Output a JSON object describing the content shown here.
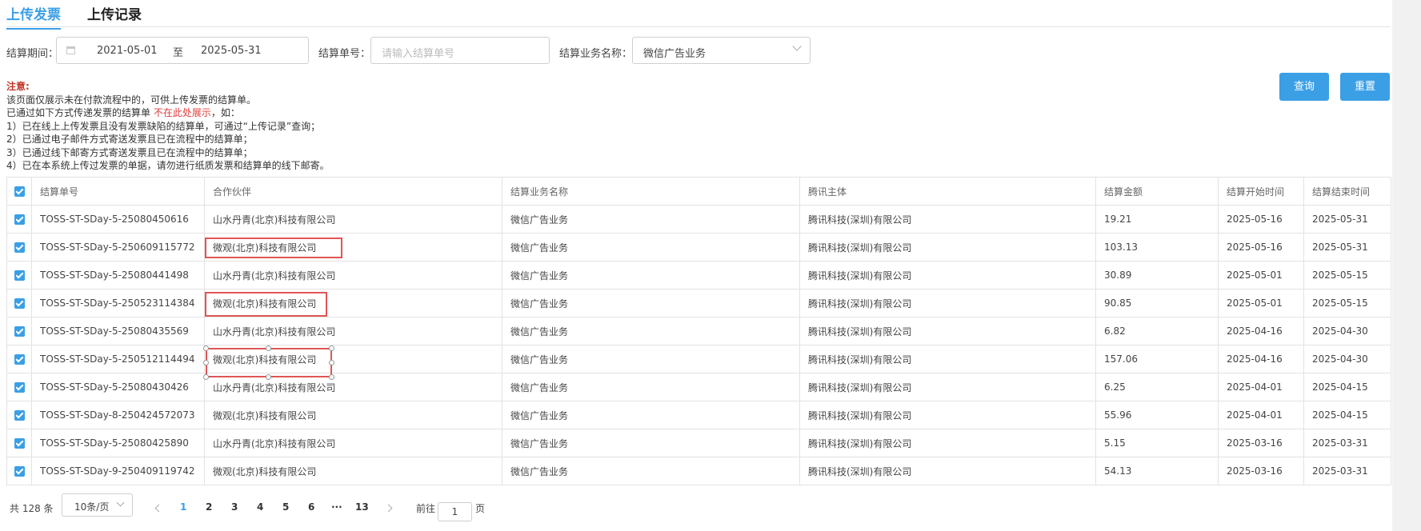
{
  "tabs": [
    {
      "label": "上传发票",
      "active": true
    },
    {
      "label": "上传记录",
      "active": false
    }
  ],
  "filters": {
    "period_label": "结算期间：",
    "start_date": "2021-05-01",
    "range_sep": "至",
    "end_date": "2025-05-31",
    "order_label": "结算单号：",
    "order_placeholder": "请输入结算单号",
    "biz_label": "结算业务名称：",
    "biz_value": "微信广告业务"
  },
  "buttons": {
    "query": "查询",
    "reset": "重置"
  },
  "notice": {
    "title": "注意:",
    "line1": "该页面仅展示未在付款流程中的，可供上传发票的结算单。",
    "line2_pre": "已通过如下方式传递发票的结算单 ",
    "line2_hl": "不在此处展示",
    "line2_post": "，如：",
    "items": [
      "1）已在线上上传发票且没有发票缺陷的结算单，可通过“上传记录”查询；",
      "2）已通过电子邮件方式寄送发票且已在流程中的结算单；",
      "3）已通过线下邮寄方式寄送发票且已在流程中的结算单；",
      "4）已在本系统上传过发票的单据，请勿进行纸质发票和结算单的线下邮寄。"
    ]
  },
  "table": {
    "headers": [
      "结算单号",
      "合作伙伴",
      "结算业务名称",
      "腾讯主体",
      "结算金额",
      "结算开始时间",
      "结算结束时间"
    ],
    "rows": [
      [
        "TOSS-ST-SDay-5-25080450616",
        "山水丹青(北京)科技有限公司",
        "微信广告业务",
        "腾讯科技(深圳)有限公司",
        "19.21",
        "2025-05-16",
        "2025-05-31"
      ],
      [
        "TOSS-ST-SDay-5-250609115772",
        "微观(北京)科技有限公司",
        "微信广告业务",
        "腾讯科技(深圳)有限公司",
        "103.13",
        "2025-05-16",
        "2025-05-31"
      ],
      [
        "TOSS-ST-SDay-5-25080441498",
        "山水丹青(北京)科技有限公司",
        "微信广告业务",
        "腾讯科技(深圳)有限公司",
        "30.89",
        "2025-05-01",
        "2025-05-15"
      ],
      [
        "TOSS-ST-SDay-5-250523114384",
        "微观(北京)科技有限公司",
        "微信广告业务",
        "腾讯科技(深圳)有限公司",
        "90.85",
        "2025-05-01",
        "2025-05-15"
      ],
      [
        "TOSS-ST-SDay-5-25080435569",
        "山水丹青(北京)科技有限公司",
        "微信广告业务",
        "腾讯科技(深圳)有限公司",
        "6.82",
        "2025-04-16",
        "2025-04-30"
      ],
      [
        "TOSS-ST-SDay-5-250512114494",
        "微观(北京)科技有限公司",
        "微信广告业务",
        "腾讯科技(深圳)有限公司",
        "157.06",
        "2025-04-16",
        "2025-04-30"
      ],
      [
        "TOSS-ST-SDay-5-25080430426",
        "山水丹青(北京)科技有限公司",
        "微信广告业务",
        "腾讯科技(深圳)有限公司",
        "6.25",
        "2025-04-01",
        "2025-04-15"
      ],
      [
        "TOSS-ST-SDay-8-250424572073",
        "微观(北京)科技有限公司",
        "微信广告业务",
        "腾讯科技(深圳)有限公司",
        "55.96",
        "2025-04-01",
        "2025-04-15"
      ],
      [
        "TOSS-ST-SDay-5-25080425890",
        "山水丹青(北京)科技有限公司",
        "微信广告业务",
        "腾讯科技(深圳)有限公司",
        "5.15",
        "2025-03-16",
        "2025-03-31"
      ],
      [
        "TOSS-ST-SDay-9-250409119742",
        "微观(北京)科技有限公司",
        "微信广告业务",
        "腾讯科技(深圳)有限公司",
        "54.13",
        "2025-03-16",
        "2025-03-31"
      ]
    ]
  },
  "pagination": {
    "total": "共 128 条",
    "page_size": "10条/页",
    "pages": [
      "1",
      "2",
      "3",
      "4",
      "5",
      "6",
      "···",
      "13"
    ],
    "current": "1",
    "goto_pre": "前往",
    "goto_value": "1",
    "goto_post": "页"
  },
  "colors": {
    "accent": "#3b9fe6",
    "highlight_box": "#e05555",
    "notice_red": "#e23b3b"
  }
}
